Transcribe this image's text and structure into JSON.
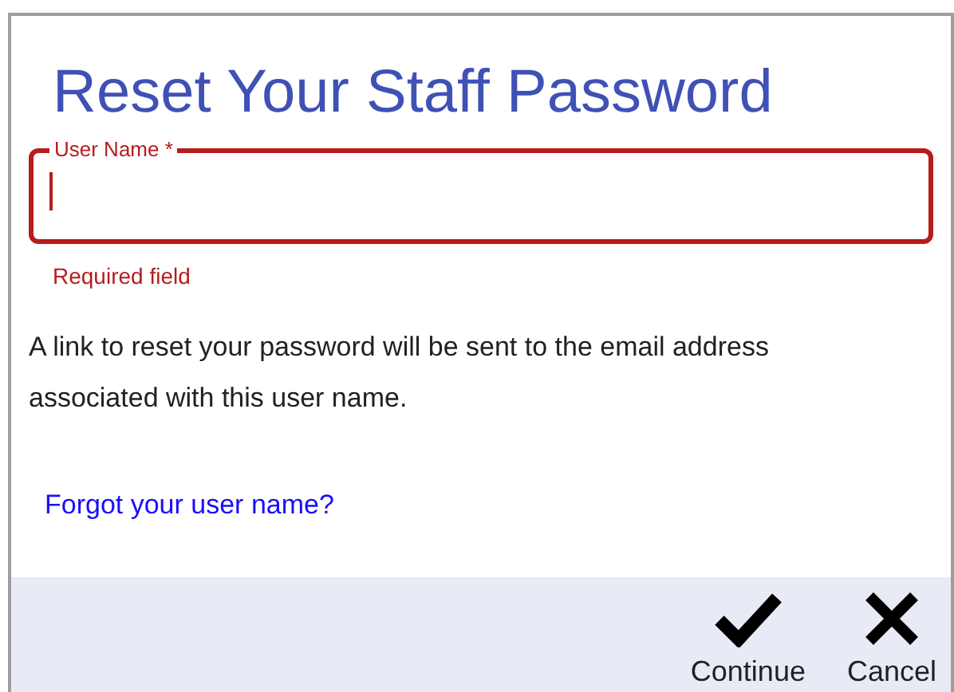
{
  "dialog": {
    "title": "Reset Your Staff Password"
  },
  "field": {
    "label": "User Name *",
    "error": true,
    "helper": "Required field"
  },
  "message": "A link to reset your password will be sent to the email address associated with this user name.",
  "link": "Forgot your user name?",
  "buttons": [
    {
      "kind": "check",
      "label": "Continue"
    },
    {
      "kind": "close",
      "label": "Cancel"
    }
  ]
}
